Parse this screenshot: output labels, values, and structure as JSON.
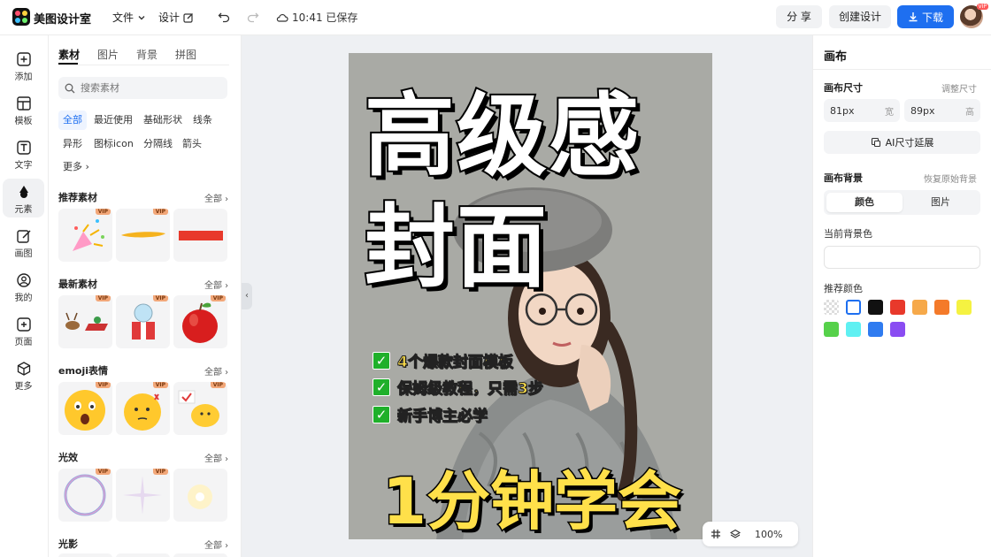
{
  "app": {
    "title": "美图设计室"
  },
  "header": {
    "menu_file": "文件",
    "menu_design": "设计",
    "save_status": "10:41 已保存",
    "share": "分 享",
    "create_design": "创建设计",
    "download": "下载",
    "avatar_badge": "VIP"
  },
  "rail": {
    "items": [
      {
        "label": "添加",
        "icon": "plus-square-icon"
      },
      {
        "label": "模板",
        "icon": "template-icon"
      },
      {
        "label": "文字",
        "icon": "text-icon"
      },
      {
        "label": "元素",
        "icon": "shapes-icon"
      },
      {
        "label": "画图",
        "icon": "pen-icon"
      },
      {
        "label": "我的",
        "icon": "user-icon"
      },
      {
        "label": "页面",
        "icon": "page-icon"
      },
      {
        "label": "更多",
        "icon": "cube-icon"
      }
    ]
  },
  "panel": {
    "tabs": [
      "素材",
      "图片",
      "背景",
      "拼图"
    ],
    "search_placeholder": "搜索素材",
    "chips": [
      "全部",
      "最近使用",
      "基础形状",
      "线条",
      "异形",
      "图标icon",
      "分隔线",
      "箭头",
      "更多"
    ],
    "vip_label": "VIP",
    "all_label": "全部",
    "sections": [
      {
        "title": "推荐素材"
      },
      {
        "title": "最新素材"
      },
      {
        "title": "emoji表情"
      },
      {
        "title": "光效"
      },
      {
        "title": "光影"
      }
    ]
  },
  "canvas": {
    "title_line1": "高级感",
    "title_line2": "封面",
    "bullets": [
      "4个爆款封面模板",
      "保姆级教程，只需3步",
      "新手博主必学"
    ],
    "check_mark": "✓",
    "bottom_title": "1分钟学会",
    "zoom": "100%",
    "colors": {
      "background": "#a9aaa5",
      "title_text": "#ffffff",
      "accent_text": "#ffe04a",
      "check": "#1fb02a"
    }
  },
  "right_panel": {
    "title": "画布",
    "size_label": "画布尺寸",
    "adjust_size": "调整尺寸",
    "width_value": "81px",
    "width_unit": "宽",
    "height_value": "89px",
    "height_unit": "高",
    "ai_extend": "AI尺寸延展",
    "bg_label": "画布背景",
    "restore_bg": "恢复原始背景",
    "seg_color": "颜色",
    "seg_image": "图片",
    "current_bg": "当前背景色",
    "recommended": "推荐颜色",
    "swatches": [
      "transparent",
      "#ffffff",
      "#111111",
      "#e8392b",
      "#f6a94a",
      "#f47a2a",
      "#f5f241",
      "#56d14a",
      "#5ff0f2",
      "#2f7bf0",
      "#8a4cf2"
    ]
  },
  "accent_color": "#1e6ff0"
}
